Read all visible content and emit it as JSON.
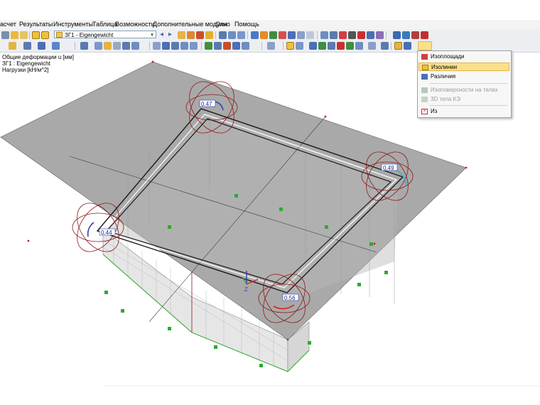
{
  "menubar": {
    "items": [
      {
        "id": "raschet",
        "label": "асчет"
      },
      {
        "id": "results",
        "label": "Результаты"
      },
      {
        "id": "tools",
        "label": "Инструменты"
      },
      {
        "id": "table",
        "label": "Таблица"
      },
      {
        "id": "options",
        "label": "Возможности"
      },
      {
        "id": "addons",
        "label": "Дополнительные модули"
      },
      {
        "id": "window",
        "label": "Окно"
      },
      {
        "id": "help",
        "label": "Помощь"
      }
    ]
  },
  "toolbar": {
    "loadcase": "ЗГ1 - Eigengewicht"
  },
  "legend": {
    "line1": "Общие деформации u [мм]",
    "line2": "ЗГ1 : Eigengewicht",
    "line3": "Нагрузки [kH/м^2]"
  },
  "viewport": {
    "values": {
      "top_left": "0.47",
      "right": "0.49",
      "left": "0.44",
      "bottom": "0.56"
    },
    "axis_label": "Z"
  },
  "dropdown": {
    "items": [
      {
        "label": "Изоплощади",
        "selected": false,
        "disabled": false,
        "icon": "isosurface-icon"
      },
      {
        "label": "Изолинии",
        "selected": true,
        "disabled": false,
        "icon": "isolines-icon"
      },
      {
        "label": "Различия",
        "selected": false,
        "disabled": false,
        "icon": "differences-icon"
      },
      {
        "label": "Изоповерхности на телах",
        "selected": false,
        "disabled": true,
        "icon": "solid-isosurface-icon"
      },
      {
        "label": "3D тела КЭ",
        "selected": false,
        "disabled": true,
        "icon": "fe-solid-icon"
      },
      {
        "label": "Из",
        "selected": false,
        "disabled": false,
        "icon": "off-icon"
      }
    ]
  },
  "colors": {
    "slab": "#a9a9a9",
    "wall": "#c4c4c4",
    "deformation": "#8b1a1a",
    "support": "#2faa2f",
    "selected_item": "#fbe08a"
  }
}
